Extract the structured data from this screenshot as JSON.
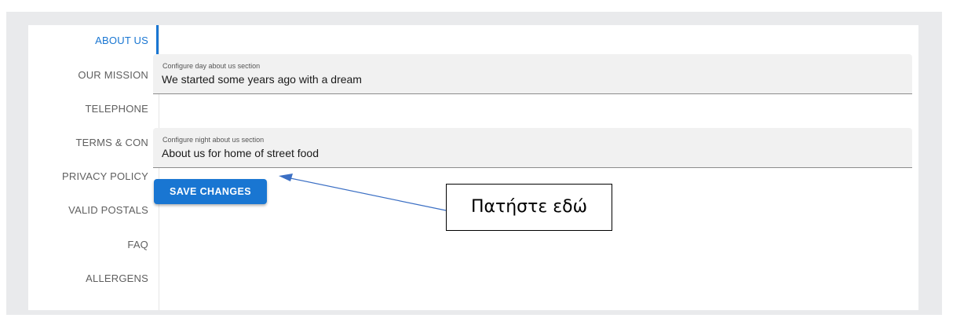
{
  "sidebar": {
    "tabs": [
      {
        "label": "ABOUT US",
        "active": true
      },
      {
        "label": "OUR MISSION",
        "active": false
      },
      {
        "label": "TELEPHONE",
        "active": false
      },
      {
        "label": "TERMS & CON",
        "active": false
      },
      {
        "label": "PRIVACY POLICY",
        "active": false
      },
      {
        "label": "VALID POSTALS",
        "active": false
      },
      {
        "label": "FAQ",
        "active": false
      },
      {
        "label": "ALLERGENS",
        "active": false
      }
    ]
  },
  "main": {
    "day_field": {
      "label": "Configure day about us section",
      "value": "We started some years ago with a dream"
    },
    "night_field": {
      "label": "Configure night about us section",
      "value": "About us for home of street food"
    },
    "save_label": "SAVE CHANGES"
  },
  "annotation": {
    "text": "Πατήστε εδώ"
  },
  "colors": {
    "accent": "#1976d2",
    "panel_background": "#e9eaec",
    "field_background": "#f1f1f1"
  }
}
